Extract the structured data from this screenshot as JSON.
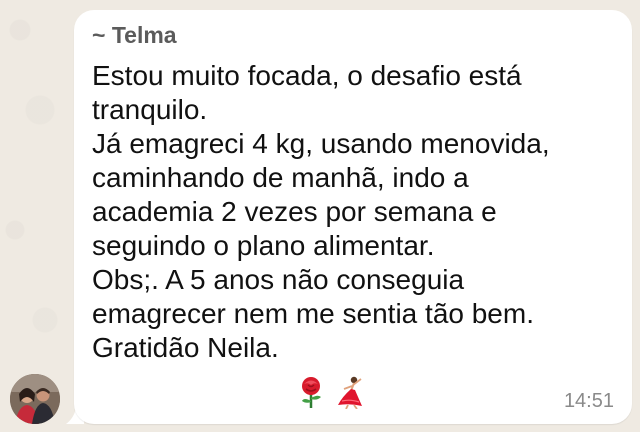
{
  "chat": {
    "message": {
      "sender": "~ Telma",
      "text": "Estou muito focada, o desafio está\ntranquilo.\nJá emagreci 4 kg, usando menovida,\ncaminhando de manhã, indo a\nacademia 2 vezes por semana e\nseguindo o plano alimentar.\nObs;. A 5 anos não conseguia\nemagrecer nem me sentia tão bem.\nGratidão Neila.",
      "emojis": [
        "rose-emoji",
        "dancer-emoji"
      ],
      "time": "14:51"
    },
    "avatar_icon": "profile-photo"
  },
  "colors": {
    "background": "#efeae2",
    "bubble": "#ffffff",
    "sender": "#5b5b5b",
    "text": "#111111",
    "time": "#8a8a8a"
  }
}
